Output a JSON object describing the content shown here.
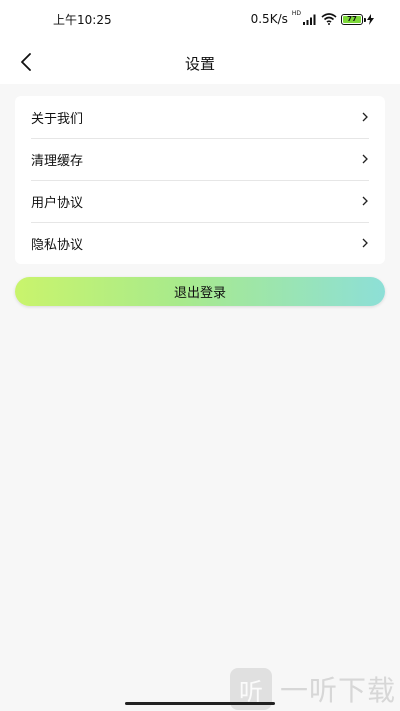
{
  "status_bar": {
    "time": "上午10:25",
    "network_speed": "0.5K/s",
    "hd_tag": "HD",
    "battery_level": "77"
  },
  "header": {
    "title": "设置"
  },
  "menu": {
    "items": [
      {
        "label": "关于我们"
      },
      {
        "label": "清理缓存"
      },
      {
        "label": "用户协议"
      },
      {
        "label": "隐私协议"
      }
    ]
  },
  "logout": {
    "label": "退出登录"
  },
  "watermark": {
    "logo_char": "听",
    "text": "一听下载"
  },
  "colors": {
    "background": "#f7f7f7",
    "logout_gradient_start": "#c9f46c",
    "logout_gradient_end": "#8ddfd7",
    "battery_fill": "#7dd83a"
  }
}
